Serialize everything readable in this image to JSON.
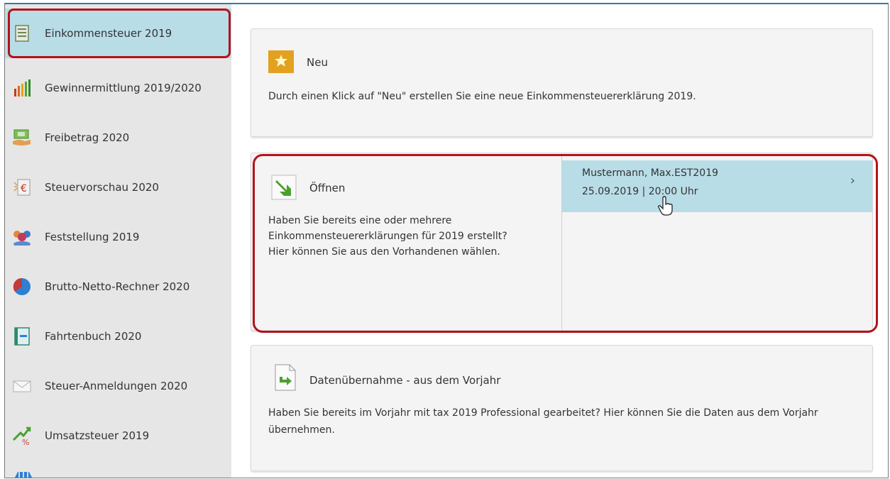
{
  "sidebar": {
    "items": [
      {
        "label": "Einkommensteuer 2019",
        "icon": "tax-document-icon",
        "active": true
      },
      {
        "label": "Gewinnermittlung 2019/2020",
        "icon": "bar-chart-icon"
      },
      {
        "label": "Freibetrag 2020",
        "icon": "money-hand-icon"
      },
      {
        "label": "Steuervorschau 2020",
        "icon": "euro-preview-icon"
      },
      {
        "label": "Feststellung 2019",
        "icon": "people-group-icon"
      },
      {
        "label": "Brutto-Netto-Rechner 2020",
        "icon": "pie-chart-icon"
      },
      {
        "label": "Fahrtenbuch 2020",
        "icon": "logbook-icon"
      },
      {
        "label": "Steuer-Anmeldungen 2020",
        "icon": "envelope-icon"
      },
      {
        "label": "Umsatzsteuer 2019",
        "icon": "percent-arrow-icon"
      }
    ]
  },
  "cards": {
    "new": {
      "title": "Neu",
      "description": "Durch einen Klick auf \"Neu\" erstellen Sie eine neue Einkommensteuererklärung 2019.",
      "icon": "new-folder-icon"
    },
    "open": {
      "title": "Öffnen",
      "description_lines": [
        "Haben Sie bereits eine oder mehrere",
        "Einkommensteuererklärungen für 2019 erstellt?",
        "Hier können Sie aus den Vorhandenen wählen."
      ],
      "icon": "open-arrow-icon",
      "recent": {
        "name": "Mustermann, Max.EST2019",
        "date": "25.09.2019 | 20:00 Uhr"
      }
    },
    "import": {
      "title": "Datenübernahme - aus dem Vorjahr",
      "description_lines": [
        "Haben Sie bereits im Vorjahr mit tax 2019 Professional gearbeitet? Hier können Sie die Daten aus dem Vorjahr",
        "übernehmen."
      ],
      "icon": "import-document-icon"
    }
  },
  "colors": {
    "accent": "#b9dde7",
    "highlight_border": "#b5121b",
    "top_border": "#2b7ea8"
  }
}
